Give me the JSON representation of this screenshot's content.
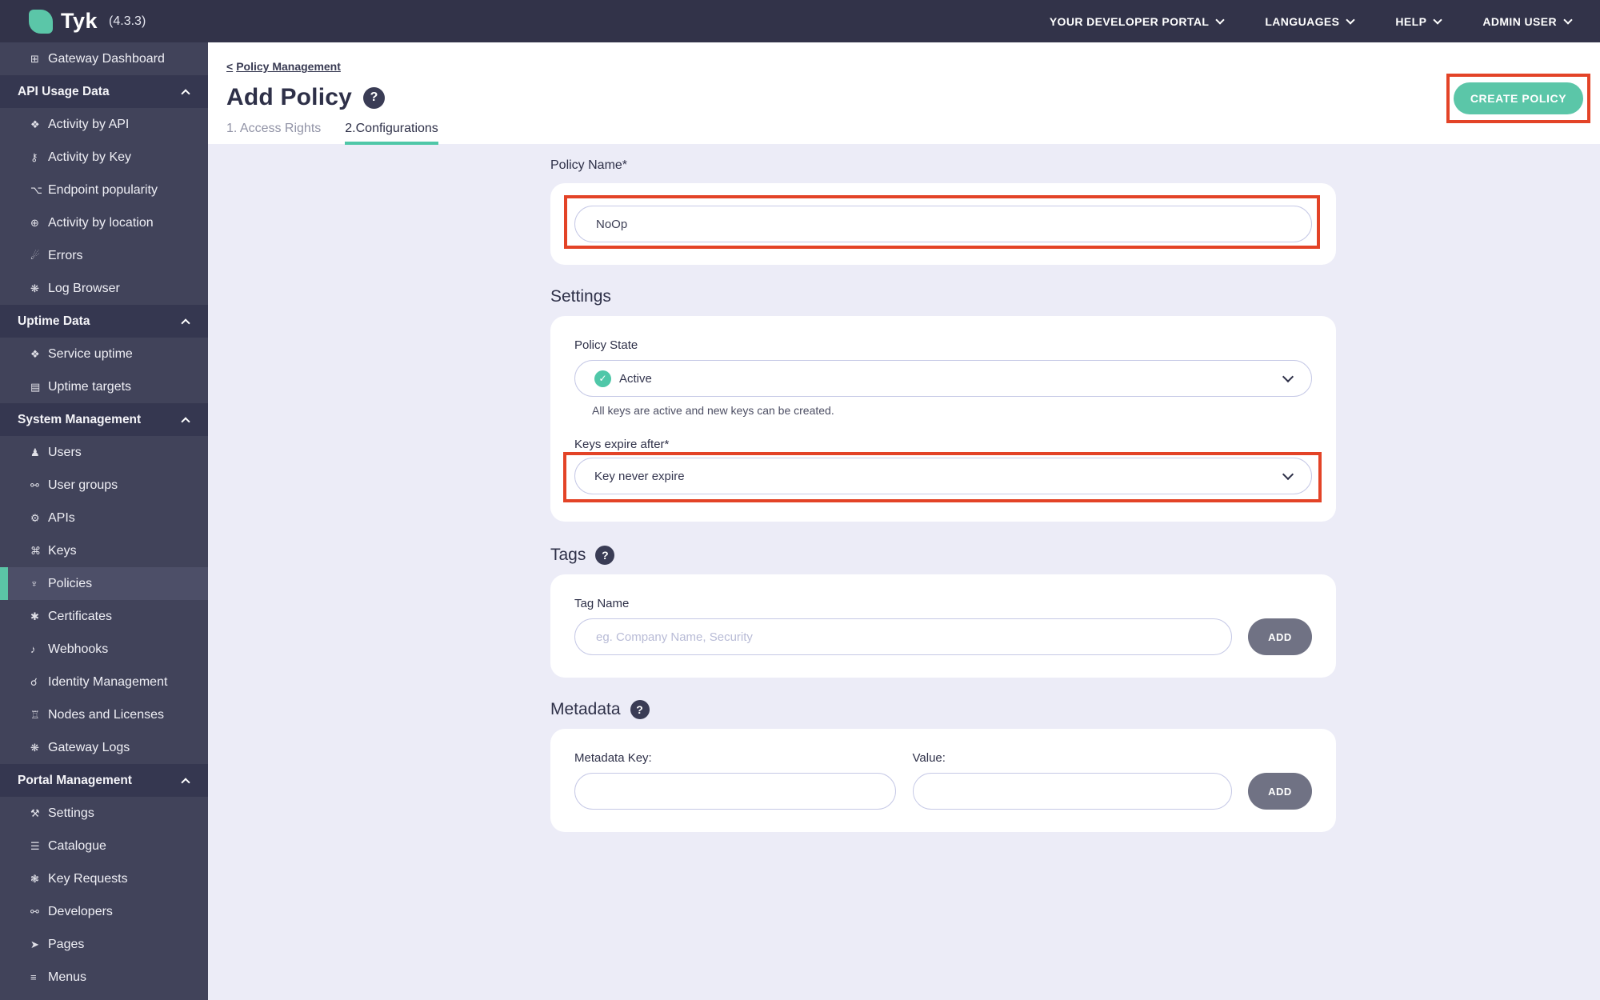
{
  "topbar": {
    "logo_text": "Tyk",
    "version": "(4.3.3)",
    "menus": [
      {
        "label": "YOUR DEVELOPER PORTAL"
      },
      {
        "label": "LANGUAGES"
      },
      {
        "label": "HELP"
      },
      {
        "label": "ADMIN USER"
      }
    ]
  },
  "sidebar": {
    "items": [
      {
        "type": "item",
        "icon": "monitor",
        "label": "Gateway Dashboard"
      },
      {
        "type": "header",
        "label": "API Usage Data"
      },
      {
        "type": "item",
        "icon": "cubes",
        "label": "Activity by API"
      },
      {
        "type": "item",
        "icon": "key",
        "label": "Activity by Key"
      },
      {
        "type": "item",
        "icon": "branch",
        "label": "Endpoint popularity"
      },
      {
        "type": "item",
        "icon": "globe",
        "label": "Activity by location"
      },
      {
        "type": "item",
        "icon": "bomb",
        "label": "Errors"
      },
      {
        "type": "item",
        "icon": "bug",
        "label": "Log Browser"
      },
      {
        "type": "header",
        "label": "Uptime Data"
      },
      {
        "type": "item",
        "icon": "cubes",
        "label": "Service uptime"
      },
      {
        "type": "item",
        "icon": "list",
        "label": "Uptime targets"
      },
      {
        "type": "header",
        "label": "System Management"
      },
      {
        "type": "item",
        "icon": "user",
        "label": "Users"
      },
      {
        "type": "item",
        "icon": "users",
        "label": "User groups"
      },
      {
        "type": "item",
        "icon": "cogs",
        "label": "APIs"
      },
      {
        "type": "item",
        "icon": "sitemap",
        "label": "Keys"
      },
      {
        "type": "item",
        "icon": "policy-key",
        "label": "Policies",
        "active": true
      },
      {
        "type": "item",
        "icon": "certificate",
        "label": "Certificates"
      },
      {
        "type": "item",
        "icon": "bell",
        "label": "Webhooks"
      },
      {
        "type": "item",
        "icon": "identity",
        "label": "Identity Management"
      },
      {
        "type": "item",
        "icon": "bank",
        "label": "Nodes and Licenses"
      },
      {
        "type": "item",
        "icon": "bug",
        "label": "Gateway Logs"
      },
      {
        "type": "header",
        "label": "Portal Management"
      },
      {
        "type": "item",
        "icon": "wrench",
        "label": "Settings"
      },
      {
        "type": "item",
        "icon": "catalogue",
        "label": "Catalogue"
      },
      {
        "type": "item",
        "icon": "key-request",
        "label": "Key Requests"
      },
      {
        "type": "item",
        "icon": "users",
        "label": "Developers"
      },
      {
        "type": "item",
        "icon": "pages",
        "label": "Pages"
      },
      {
        "type": "item",
        "icon": "menus",
        "label": "Menus"
      }
    ]
  },
  "header": {
    "breadcrumb_back": "<",
    "breadcrumb": "Policy Management",
    "title": "Add Policy",
    "help_badge": "?",
    "tabs": [
      {
        "label": "1. Access Rights",
        "active": false
      },
      {
        "label": "2.Configurations",
        "active": true
      }
    ],
    "create_button": "CREATE POLICY"
  },
  "form": {
    "policy_name": {
      "label": "Policy Name*",
      "value": "NoOp"
    },
    "settings": {
      "heading": "Settings",
      "policy_state": {
        "label": "Policy State",
        "value": "Active",
        "check_glyph": "✓",
        "helper": "All keys are active and new keys can be created."
      },
      "keys_expire": {
        "label": "Keys expire after*",
        "value": "Key never expire"
      }
    },
    "tags": {
      "heading": "Tags",
      "help_badge": "?",
      "label": "Tag Name",
      "placeholder": "eg. Company Name, Security",
      "add_button": "ADD"
    },
    "metadata": {
      "heading": "Metadata",
      "help_badge": "?",
      "key_label": "Metadata Key:",
      "value_label": "Value:",
      "add_button": "ADD"
    }
  },
  "colors": {
    "accent_teal": "#5BC6A8",
    "annotation_red": "#E34327",
    "topbar_bg": "#323349",
    "sidebar_bg": "#41435A",
    "content_bg": "#ECECF7"
  }
}
